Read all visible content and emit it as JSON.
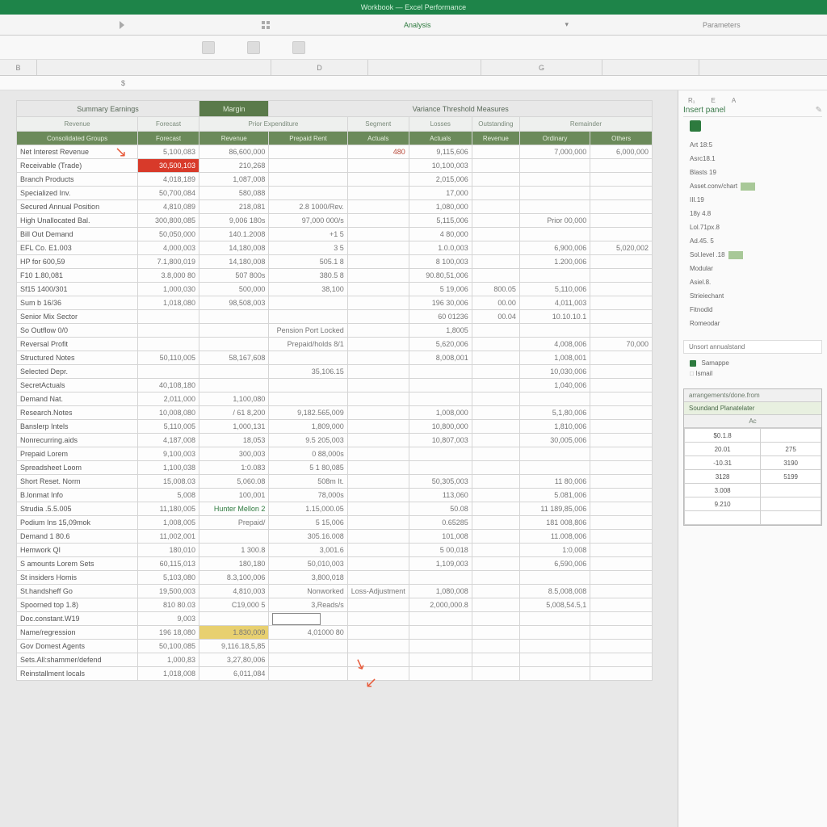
{
  "app": {
    "title": "Workbook — Excel Performance",
    "formula_hint": "$"
  },
  "ribbon": {
    "tabs": [
      "Analysis",
      "Parameters"
    ]
  },
  "columns": [
    "B",
    "D",
    "G"
  ],
  "table": {
    "groups": [
      {
        "label": "Summary Earnings",
        "span": 2,
        "dark": false
      },
      {
        "label": "Margin",
        "span": 1,
        "dark": true
      },
      {
        "label": "Variance Threshold Measures",
        "span": 6,
        "dark": false
      }
    ],
    "headers_top": [
      "Revenue",
      "Forecast",
      "Prior Expenditure",
      "Segment",
      "Losses",
      "Outstanding",
      "Remainder"
    ],
    "headers_sub": [
      "Consolidated Groups",
      "Forecast",
      "Revenue",
      "Prepaid Rent",
      "Actuals",
      "Actuals",
      "Revenue",
      "Ordinary",
      "Others"
    ],
    "rows": [
      {
        "label": "Net Interest Revenue",
        "cells": [
          "5,100,083",
          "86,600,000",
          "",
          "480",
          "9,115,606",
          "",
          "7,000,000",
          "6,000,000"
        ],
        "flags": {}
      },
      {
        "label": "Receivable (Trade)",
        "cells": [
          "30,500,103",
          "210,268",
          "",
          "",
          "10,100,003",
          "",
          "",
          ""
        ],
        "flags": {
          "0": "highlight-red"
        }
      },
      {
        "label": "Branch Products",
        "cells": [
          "4,018,189",
          "1,087,008",
          "",
          "",
          "2,015,006",
          "",
          "",
          ""
        ],
        "flags": {}
      },
      {
        "label": "Specialized Inv.",
        "cells": [
          "50,700,084",
          "580,088",
          "",
          "",
          "17,000",
          "",
          "",
          ""
        ],
        "flags": {}
      },
      {
        "label": "Secured Annual Position",
        "cells": [
          "4,810,089",
          "218,081",
          "2.8 1000/Rev.",
          "",
          "1,080,000",
          "",
          "",
          ""
        ],
        "flags": {}
      },
      {
        "label": "High Unallocated Bal.",
        "cells": [
          "300,800,085",
          "9,006 180s",
          "97,000 000/s",
          "",
          "5,115,006",
          "",
          "Prior 00,000",
          ""
        ],
        "flags": {}
      },
      {
        "label": "Bill Out Demand",
        "cells": [
          "50,050,000",
          "140.1.2008",
          "+1  5",
          "",
          "4 80,000",
          "",
          "",
          ""
        ],
        "flags": {}
      },
      {
        "label": "EFL Co. E1.003",
        "cells": [
          "4,000,003",
          "14,180,008",
          "3  5",
          "",
          "1.0.0,003",
          "",
          "6,900,006",
          "5,020,002"
        ],
        "flags": {}
      },
      {
        "label": "HP  for 600,59",
        "cells": [
          "7.1,800,019",
          "14,180,008",
          "505.1  8",
          "",
          "8 100,003",
          "",
          "1.200,006",
          ""
        ],
        "flags": {}
      },
      {
        "label": "F10  1.80,081",
        "cells": [
          "3.8,000 80",
          "507 800s",
          "380.5  8",
          "",
          "90.80,51,006",
          "",
          "",
          ""
        ],
        "flags": {}
      },
      {
        "label": "Sf15 1400/301",
        "cells": [
          "1,000,030",
          "500,000",
          "38,100",
          "",
          "5 19,006",
          "800.05",
          "5,110,006",
          ""
        ],
        "flags": {}
      },
      {
        "label": "Sum b 16/36",
        "cells": [
          "1,018,080",
          "98,508,003",
          "",
          "",
          "196 30,006",
          "00.00",
          "4,011,003",
          ""
        ],
        "flags": {}
      },
      {
        "label": "Senior Mix Sector",
        "cells": [
          "",
          "",
          "",
          "",
          "60 01236",
          "00.04",
          "10.10.10.1",
          ""
        ],
        "flags": {}
      },
      {
        "label": "So Outflow 0/0",
        "cells": [
          "",
          "",
          "Pension Port Locked",
          "",
          "1,8005",
          "",
          "",
          ""
        ],
        "flags": {}
      },
      {
        "label": "Reversal Profit",
        "cells": [
          "",
          "",
          "Prepaid/holds   8/1",
          "",
          "5,620,006",
          "",
          "4,008,006",
          "70,000"
        ],
        "flags": {}
      },
      {
        "label": "Structured Notes",
        "cells": [
          "50,110,005",
          "58,167,608",
          "",
          "",
          "8,008,001",
          "",
          "1,008,001",
          ""
        ],
        "flags": {}
      },
      {
        "label": "Selected Depr.",
        "cells": [
          "",
          "",
          "35,106.15",
          "",
          "",
          "",
          "10,030,006",
          ""
        ],
        "flags": {}
      },
      {
        "label": "SecretActuals",
        "cells": [
          "40,108,180",
          "",
          "",
          "",
          "",
          "",
          "1,040,006",
          ""
        ],
        "flags": {}
      },
      {
        "label": "Demand Nat.",
        "cells": [
          "2,011,000",
          "1,100,080",
          "",
          "",
          "",
          "",
          "",
          ""
        ],
        "flags": {}
      },
      {
        "label": "Research.Notes",
        "cells": [
          "10,008,080",
          "/ 61 8,200",
          "9,182.565,009",
          "",
          "1,008,000",
          "",
          "5,1,80,006",
          ""
        ],
        "flags": {}
      },
      {
        "label": "Banslerp Intels",
        "cells": [
          "5,110,005",
          "1,000,131",
          "1,809,000",
          "",
          "10,800,000",
          "",
          "1,810,006",
          ""
        ],
        "flags": {}
      },
      {
        "label": "Nonrecurring.aids",
        "cells": [
          "4,187,008",
          "18,053",
          "9.5 205,003",
          "",
          "10,807,003",
          "",
          "30,005,006",
          ""
        ],
        "flags": {}
      },
      {
        "label": "Prepaid Lorem",
        "cells": [
          "9,100,003",
          "300,003",
          "0  88,000s",
          "",
          "",
          "",
          "",
          ""
        ],
        "flags": {}
      },
      {
        "label": "Spreadsheet Loom",
        "cells": [
          "1,100,038",
          "1:0.083",
          "5 1 80,085",
          "",
          "",
          "",
          "",
          ""
        ],
        "flags": {}
      },
      {
        "label": "Short Reset. Norm",
        "cells": [
          "15,008.03",
          "5,060.08",
          "508m  It.",
          "",
          "50,305,003",
          "",
          "11  80,006",
          ""
        ],
        "flags": {}
      },
      {
        "label": "B.lonmat Info",
        "cells": [
          "5,008",
          "100,001",
          "78,000s",
          "",
          "113,060",
          "",
          "5.081,006",
          ""
        ],
        "flags": {}
      },
      {
        "label": "Strudia  .5.5.005",
        "cells": [
          "11,180,005",
          "Hunter Mellon 2",
          "1.15,000.05",
          "",
          "50.08",
          "",
          "11 189,85,006",
          ""
        ],
        "flags": {
          "2_green": true
        }
      },
      {
        "label": "Podium Ins 15,09mok",
        "cells": [
          "1,008,005",
          "Prepaid/",
          "5 15,006",
          "",
          "0.65285",
          "",
          "181 008,806",
          ""
        ],
        "flags": {}
      },
      {
        "label": "Demand 1 80.6",
        "cells": [
          "11,002,001",
          "",
          "305.16.008",
          "",
          "101,008",
          "",
          "11.008,006",
          ""
        ],
        "flags": {}
      },
      {
        "label": "Hemwork QI",
        "cells": [
          "180,010",
          "1 300.8",
          "3,001.6",
          "",
          "5 00,018",
          "",
          "1:0,008",
          ""
        ],
        "flags": {}
      },
      {
        "label": "S amounts Lorem Sets",
        "cells": [
          "60,115,013",
          "180,180",
          "50,010,003",
          "",
          "1,109,003",
          "",
          "6,590,006",
          ""
        ],
        "flags": {}
      },
      {
        "label": "St insiders Homis",
        "cells": [
          "5,103,080",
          "8.3,100,006",
          "3,800,018",
          "",
          "",
          "",
          "",
          ""
        ],
        "flags": {}
      },
      {
        "label": "St.handsheff Go",
        "cells": [
          "19,500,003",
          "4,810,003",
          "Nonworked",
          "Loss-Adjustment",
          "1,080,008",
          "",
          "8.5,008,008",
          ""
        ],
        "flags": {}
      },
      {
        "label": "Spoorned top 1.8) ",
        "cells": [
          "810 80.03",
          "C19,000 5",
          "3,Reads/s",
          "",
          "2,000,000.8",
          "",
          "5,008,54.5,1",
          ""
        ],
        "flags": {}
      },
      {
        "label": "Doc.constant.W19",
        "cells": [
          "    9,003",
          "",
          "",
          "",
          "",
          "",
          "",
          ""
        ],
        "flags": {
          "cell_input": 2
        }
      },
      {
        "label": "Name/regression",
        "cells": [
          "196 18,080",
          "1.830,009",
          "4,01000 80",
          "",
          "",
          "",
          "",
          ""
        ],
        "flags": {
          "1": "highlight-yellow"
        }
      },
      {
        "label": "Gov Domest Agents",
        "cells": [
          "50,100,085",
          "9,116.18,5,85",
          "",
          "",
          "",
          "",
          "",
          ""
        ],
        "flags": {}
      },
      {
        "label": "Sets.All:shammer/defend",
        "cells": [
          "1,000,83",
          "3,27,80,006",
          "",
          "",
          "",
          "",
          "",
          ""
        ],
        "flags": {}
      },
      {
        "label": "Reinstallment locals",
        "cells": [
          "1,018,008",
          "6,011,084",
          "",
          "",
          "",
          "",
          "",
          ""
        ],
        "flags": {}
      }
    ]
  },
  "mid_labels": {
    "a": "Pension Port Locked",
    "b": "Prepaid/holds   8/1"
  },
  "side": {
    "title": "Insert panel",
    "cols": [
      "R₁",
      "E",
      "A"
    ],
    "items": [
      "Art 18:5",
      "Asrc18.1",
      "Blasts 19",
      "Asset.conv/chart",
      "III.19",
      "18y 4.8",
      "Lol.71px.8",
      "Ad.45.  5",
      "Sol.level  .18",
      "Modular",
      "Asiel.8.",
      "Strieiechant",
      "Fitnodid",
      "Romeodar"
    ],
    "box": "Unsort annualstand",
    "chip_a": "Samappe",
    "chip_b": "Ismail",
    "mini": {
      "super": "arrangements/done.from",
      "header": "Soundand Planatelater",
      "sub": "Ac",
      "rows": [
        [
          "$0.1.8",
          ""
        ],
        [
          "20.01",
          "275"
        ],
        [
          "-10.31",
          "3190"
        ],
        [
          "3128",
          "5199"
        ],
        [
          "3.008",
          ""
        ],
        [
          "9.210",
          ""
        ],
        [
          "",
          ""
        ]
      ]
    }
  }
}
